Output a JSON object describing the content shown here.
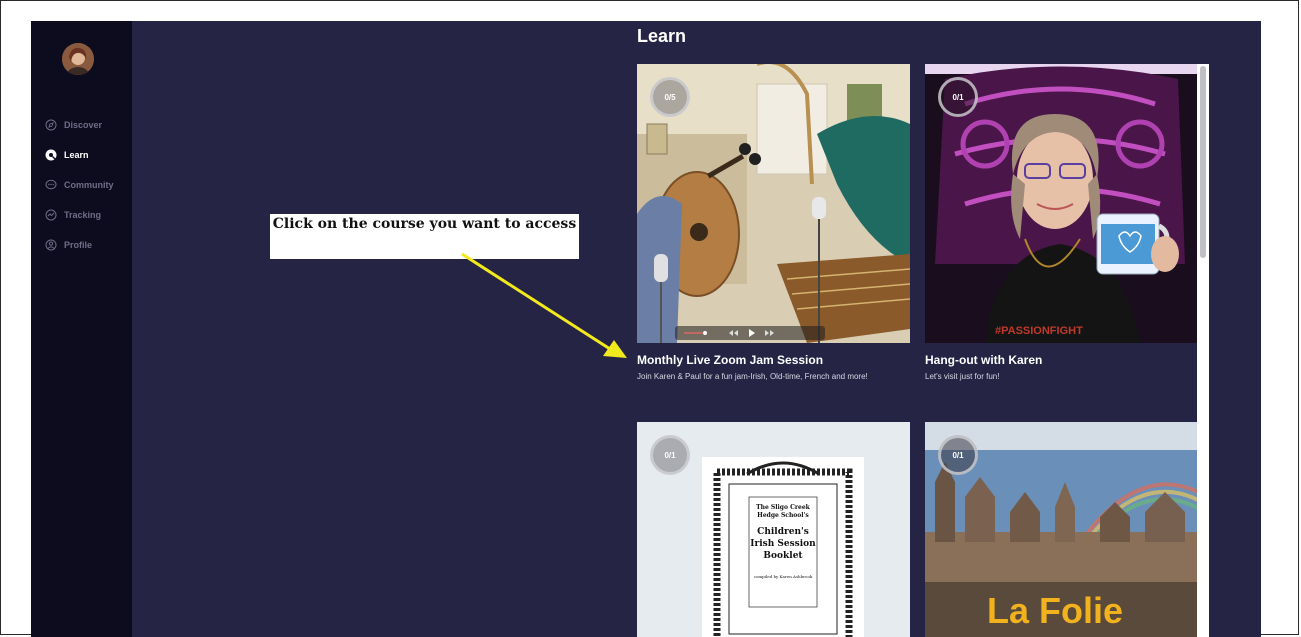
{
  "sidebar": {
    "items": [
      {
        "label": "Discover",
        "icon": "compass-icon",
        "active": false
      },
      {
        "label": "Learn",
        "icon": "learn-icon",
        "active": true
      },
      {
        "label": "Community",
        "icon": "chat-icon",
        "active": false
      },
      {
        "label": "Tracking",
        "icon": "chart-icon",
        "active": false
      },
      {
        "label": "Profile",
        "icon": "user-icon",
        "active": false
      }
    ]
  },
  "main": {
    "title": "Learn",
    "courses": [
      {
        "progress": "0/5",
        "title": "Monthly Live Zoom Jam Session",
        "description": "Join Karen & Paul  for a fun jam-Irish, Old-time, French and more!"
      },
      {
        "progress": "0/1",
        "title": "Hang-out with Karen",
        "description": "Let's visit just for fun!"
      },
      {
        "progress": "0/1",
        "booklet": {
          "line1": "The Sligo Creek",
          "line2": "Hedge School's",
          "title1": "Children's",
          "title2": "Irish Session",
          "title3": "Booklet",
          "credit": "compiled by Karen Ashbrook"
        }
      },
      {
        "progress": "0/1",
        "overlay_text": "La Folie"
      }
    ]
  },
  "annotation": {
    "callout_text": "Click on the course you want to access"
  },
  "colors": {
    "app_bg": "#252444",
    "sidebar_bg": "#0d0c1f",
    "arrow": "#f2ea1c"
  }
}
